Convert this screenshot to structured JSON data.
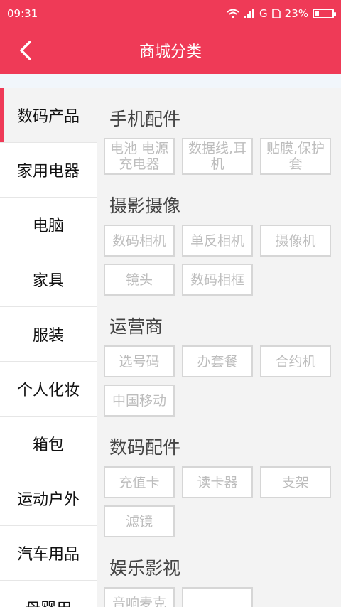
{
  "theme": {
    "brand": "#ef3a57"
  },
  "status": {
    "time": "09:31",
    "network": "G",
    "battery": "23%",
    "battery_level": 0.23
  },
  "header": {
    "title": "商城分类",
    "back_icon": "chevron-left-icon"
  },
  "sidebar": {
    "items": [
      {
        "label": "数码产品",
        "active": true
      },
      {
        "label": "家用电器"
      },
      {
        "label": "电脑"
      },
      {
        "label": "家具"
      },
      {
        "label": "服装"
      },
      {
        "label": "个人化妆"
      },
      {
        "label": "箱包"
      },
      {
        "label": "运动户外"
      },
      {
        "label": "汽车用品"
      },
      {
        "label": "母婴用"
      }
    ]
  },
  "content": {
    "sections": [
      {
        "title": "手机配件",
        "chips": [
          "电池 电源充电器",
          "数据线,耳机",
          "贴膜,保护套"
        ]
      },
      {
        "title": "摄影摄像",
        "chips": [
          "数码相机",
          "单反相机",
          "摄像机",
          "镜头",
          "数码相框"
        ]
      },
      {
        "title": "运营商",
        "chips": [
          "选号码",
          "办套餐",
          "合约机",
          "中国移动"
        ]
      },
      {
        "title": "数码配件",
        "chips": [
          "充值卡",
          "读卡器",
          "支架",
          "滤镜"
        ]
      },
      {
        "title": "娱乐影视",
        "chips": [
          "音响麦克",
          ""
        ]
      }
    ]
  }
}
